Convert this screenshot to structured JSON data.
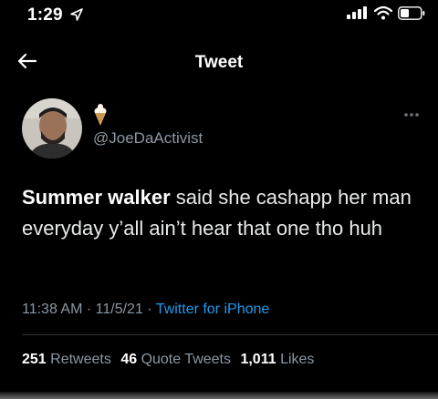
{
  "status_bar": {
    "time": "1:29",
    "icons": [
      "location-arrow-icon",
      "cellular-signal-icon",
      "wifi-icon",
      "battery-icon"
    ]
  },
  "nav": {
    "back_icon": "back-arrow-icon",
    "title": "Tweet"
  },
  "tweet": {
    "author": {
      "name_emoji": "ice-cream-icon",
      "handle": "@JoeDaActivist",
      "avatar": "avatar"
    },
    "text_bold": "Summer walker",
    "text_rest": " said she cashapp her man everyday y’all ain’t hear that one tho huh",
    "time": "11:38 AM",
    "separator": "·",
    "date": "11/5/21",
    "source": "Twitter for iPhone",
    "more_icon": "more-dots-icon"
  },
  "stats": {
    "retweets": {
      "count": "251",
      "label": "Retweets"
    },
    "quotes": {
      "count": "46",
      "label": "Quote Tweets"
    },
    "likes": {
      "count": "1,011",
      "label": "Likes"
    }
  },
  "colors": {
    "background": "#000000",
    "text": "#e7e9ea",
    "muted": "#8b98a5",
    "accent": "#1d9bf0",
    "divider": "#2f3336"
  }
}
